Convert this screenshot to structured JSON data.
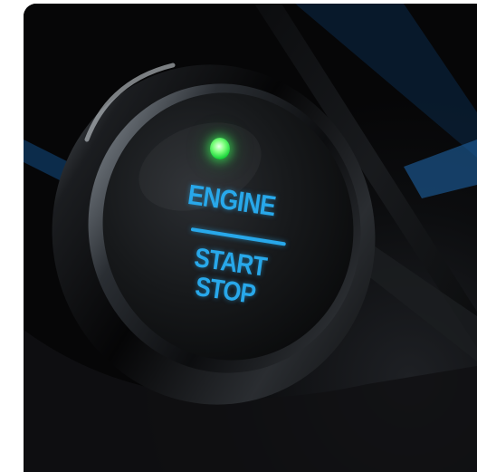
{
  "button": {
    "line1": "ENGINE",
    "line2": "START",
    "line3": "STOP"
  },
  "colors": {
    "label_blue": "#28a8ea",
    "indicator_green": "#2ee84f",
    "background": "#0b0c0e"
  },
  "indicator": {
    "state": "on"
  }
}
